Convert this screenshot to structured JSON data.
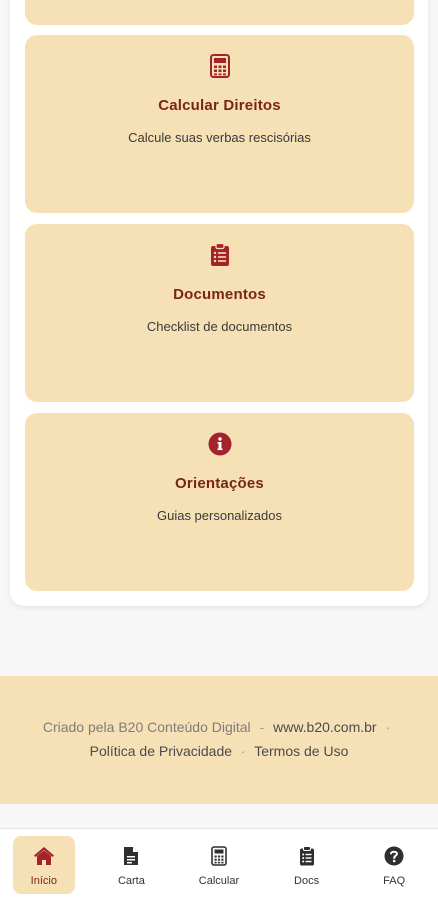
{
  "colors": {
    "accent": "#a3232b",
    "card_bg": "#f6e0b6",
    "title": "#7a2617",
    "dark_icon": "#3a3a3a"
  },
  "cards": [
    {
      "icon": "calculator-icon",
      "title": "Calcular Direitos",
      "description": "Calcule suas verbas rescisórias"
    },
    {
      "icon": "clipboard-icon",
      "title": "Documentos",
      "description": "Checklist de documentos"
    },
    {
      "icon": "info-icon",
      "title": "Orientações",
      "description": "Guias personalizados"
    }
  ],
  "footer": {
    "credit": "Criado pela B20 Conteúdo Digital",
    "site": "www.b20.com.br",
    "privacy": "Política de Privacidade",
    "terms": "Termos de Uso",
    "separator": "·"
  },
  "nav": [
    {
      "label": "Início",
      "icon": "home-icon",
      "active": true
    },
    {
      "label": "Carta",
      "icon": "document-icon",
      "active": false
    },
    {
      "label": "Calcular",
      "icon": "calculator-icon",
      "active": false
    },
    {
      "label": "Docs",
      "icon": "clipboard-icon",
      "active": false
    },
    {
      "label": "FAQ",
      "icon": "help-icon",
      "active": false
    }
  ]
}
